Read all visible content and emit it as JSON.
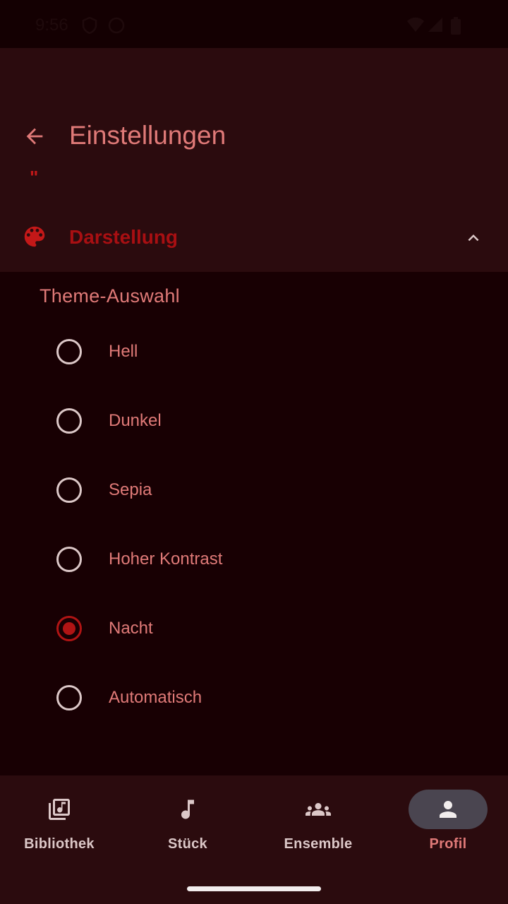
{
  "status_bar": {
    "time": "9:56",
    "icons": [
      "shield-icon",
      "sync-icon",
      "wifi-icon",
      "signal-icon",
      "battery-icon"
    ]
  },
  "app_bar": {
    "back_icon": "arrow-back-icon",
    "title": "Einstellungen",
    "quote_mark": "\""
  },
  "section": {
    "icon": "palette-icon",
    "title": "Darstellung",
    "chevron": "chevron-up-icon",
    "expanded": true
  },
  "theme": {
    "label": "Theme-Auswahl",
    "selected": "Nacht",
    "options": [
      {
        "label": "Hell",
        "selected": false
      },
      {
        "label": "Dunkel",
        "selected": false
      },
      {
        "label": "Sepia",
        "selected": false
      },
      {
        "label": "Hoher Kontrast",
        "selected": false
      },
      {
        "label": "Nacht",
        "selected": true
      },
      {
        "label": "Automatisch",
        "selected": false
      }
    ]
  },
  "bottom_nav": {
    "active": "Profil",
    "items": [
      {
        "label": "Bibliothek",
        "icon": "library-music-icon"
      },
      {
        "label": "Stück",
        "icon": "music-note-icon"
      },
      {
        "label": "Ensemble",
        "icon": "groups-icon"
      },
      {
        "label": "Profil",
        "icon": "person-icon"
      }
    ]
  },
  "colors": {
    "background": "#180003",
    "surface": "#2b0b0e",
    "accent": "#e07a78",
    "primary": "#a80f12",
    "on_surface": "#dcc8c8",
    "indicator": "#4a4550"
  }
}
